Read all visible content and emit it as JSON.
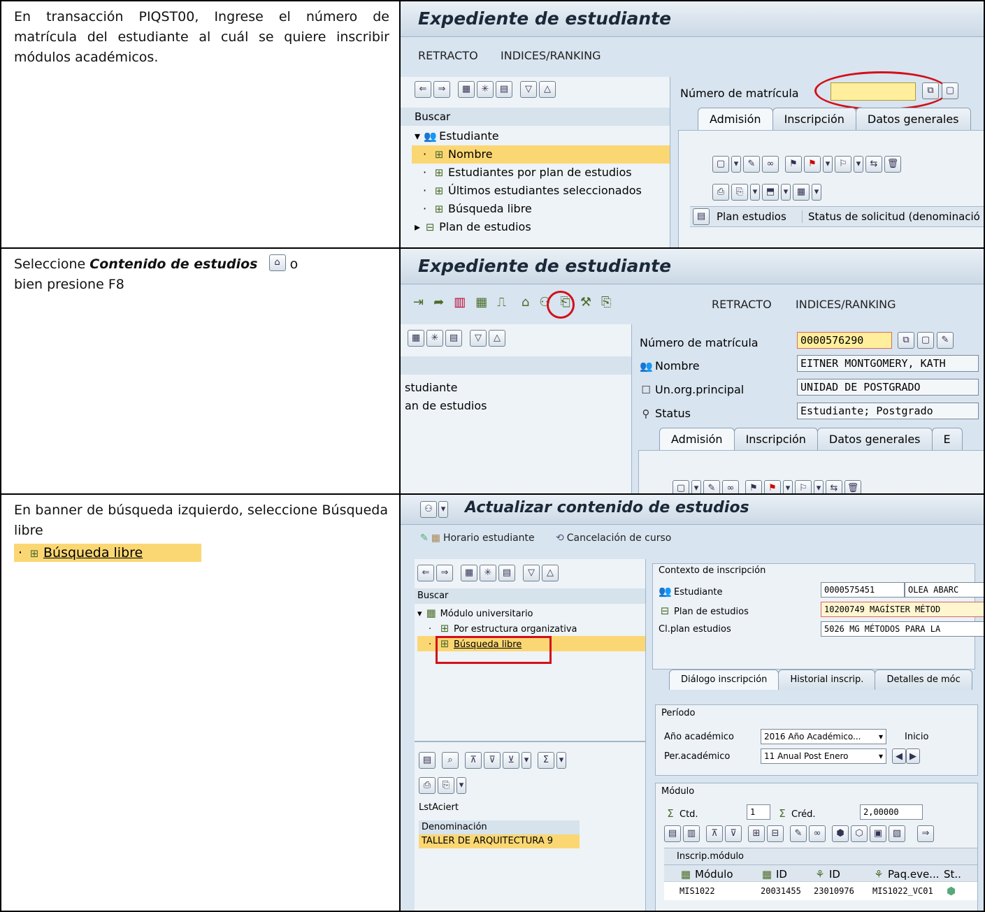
{
  "steps": [
    {
      "text": "En transacción PIQST00, Ingrese el número de matrícula del estudiante al cuál se quiere inscribir módulos académicos.",
      "screen": {
        "title": "Expediente de estudiante",
        "menu": [
          "RETRACTO",
          "INDICES/RANKING"
        ],
        "search_label": "Buscar",
        "tree": [
          "Estudiante",
          "Nombre",
          "Estudiantes por plan de estudios",
          "Últimos estudiantes seleccionados",
          "Búsqueda libre",
          "Plan de estudios"
        ],
        "field_label": "Número de matrícula",
        "tabs": [
          "Admisión",
          "Inscripción",
          "Datos generales"
        ],
        "columns": [
          "Plan estudios",
          "Status de solicitud (denominació"
        ]
      }
    },
    {
      "text_plain": "Seleccione ",
      "text_bold": "Contenido de estudios",
      "text_after": " o",
      "text_line2": "bien presione F8",
      "screen": {
        "title": "Expediente de estudiante",
        "menu": [
          "RETRACTO",
          "INDICES/RANKING"
        ],
        "tree": [
          "studiante",
          "an de estudios"
        ],
        "fields": [
          {
            "label": "Número de matrícula",
            "value": "0000576290"
          },
          {
            "label": "Nombre",
            "value": "EITNER MONTGOMERY, KATH"
          },
          {
            "label": "Un.org.principal",
            "value": "UNIDAD DE POSTGRADO"
          },
          {
            "label": "Status",
            "value": "Estudiante; Postgrado"
          }
        ],
        "tabs": [
          "Admisión",
          "Inscripción",
          "Datos generales",
          "E"
        ]
      }
    },
    {
      "text": "En banner de búsqueda izquierdo, seleccione Búsqueda libre",
      "inline_item": "Búsqueda libre",
      "screen": {
        "title": "Actualizar contenido de estudios",
        "menu": [
          "Horario estudiante",
          "Cancelación de curso"
        ],
        "search_label": "Buscar",
        "tree": [
          "Módulo universitario",
          "Por estructura organizativa",
          "Búsqueda libre"
        ],
        "list_label": "LstAciert",
        "list_header": "Denominación",
        "list_item": "TALLER DE ARQUITECTURA 9",
        "context_title": "Contexto de inscripción",
        "context": [
          {
            "label": "Estudiante",
            "value": "0000575451",
            "extra": "OLEA ABARC"
          },
          {
            "label": "Plan de estudios",
            "value": "10200749 MAGÍSTER MÉTOD"
          },
          {
            "label": "Cl.plan estudios",
            "value": "5026 MG MÉTODOS PARA LA"
          }
        ],
        "tabs": [
          "Diálogo inscripción",
          "Historial inscrip.",
          "Detalles de móc"
        ],
        "periodo_title": "Período",
        "periodo": [
          {
            "label": "Año académico",
            "value": "2016 Año Académico...",
            "extra": "Inicio"
          },
          {
            "label": "Per.académico",
            "value": "11 Anual Post Enero"
          }
        ],
        "modulo_title": "Módulo",
        "ctd_label": "Ctd.",
        "ctd_value": "1",
        "cred_label": "Créd.",
        "cred_value": "2,00000",
        "inscrip_title": "Inscrip.módulo",
        "table_headers": [
          "Módulo",
          "ID",
          "ID",
          "Paq.eve...",
          "St.."
        ],
        "table_row": [
          "MIS1022",
          "20031455",
          "23010976",
          "MIS1022_VC01"
        ]
      }
    }
  ]
}
